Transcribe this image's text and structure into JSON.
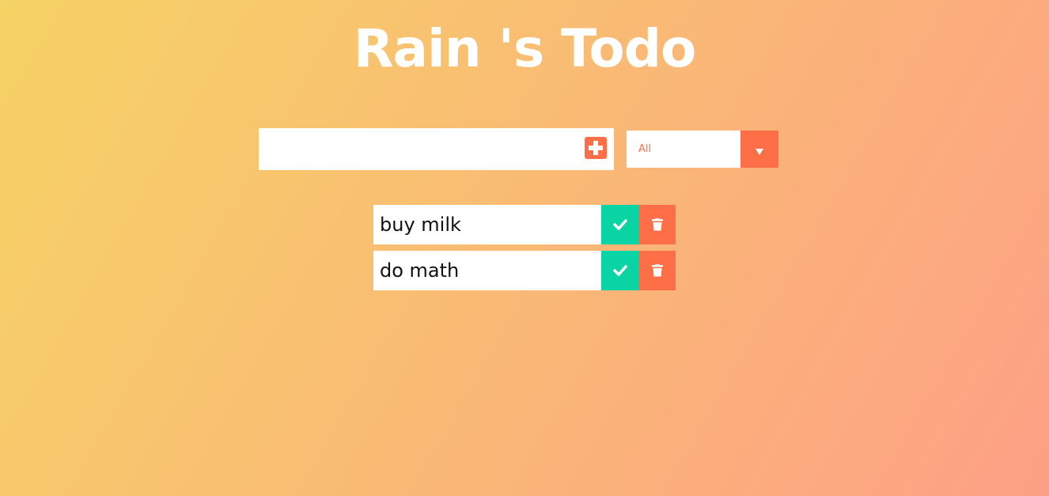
{
  "header": {
    "title": "Rain 's Todo"
  },
  "todo_input": {
    "value": "",
    "placeholder": "",
    "add_icon": "plus-square-icon"
  },
  "filter": {
    "selected": "All",
    "arrow_icon": "caret-down-icon"
  },
  "todos": [
    {
      "text": "buy milk",
      "complete_icon": "check-icon",
      "delete_icon": "trash-icon"
    },
    {
      "text": "do math",
      "complete_icon": "check-icon",
      "delete_icon": "trash-icon"
    }
  ],
  "colors": {
    "gradient_start": "#f6d365",
    "gradient_end": "#fda085",
    "accent": "#ff6f47",
    "complete": "#0ad4a4",
    "text": "#111111"
  }
}
